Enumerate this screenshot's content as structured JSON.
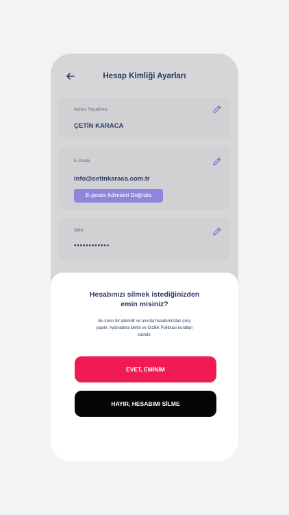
{
  "header": {
    "title": "Hesap Kimliği Ayarları",
    "back_icon": "arrow-left-icon"
  },
  "fields": {
    "name": {
      "label": "Adınız Soyadınız",
      "value": "ÇETİN KARACA"
    },
    "email": {
      "label": "E-Posta",
      "value": "info@cetinkaraca.com.tr",
      "verify_label": "E-posta Adresini Doğrula"
    },
    "password": {
      "label": "Şifre",
      "value": "••••••••••••"
    }
  },
  "dialog": {
    "title_line1": "Hesabınızı silmek istediğinizden",
    "title_line2": "emin misiniz?",
    "desc_line1": "Bu kalıcı bir işlemdir ve anında hesabımızdan çıkış",
    "desc_line2": "yapılır. Aydınlatma Metni ve Gizlilik Politikası kuralları",
    "desc_line3": "saklıdır.",
    "confirm_label": "EVET, EMİNİM",
    "cancel_label": "HAYIR, HESABIMI SİLME"
  },
  "colors": {
    "accent": "#8e86dc",
    "title": "#2b3a67",
    "confirm": "#ee1c52",
    "cancel": "#050505"
  }
}
